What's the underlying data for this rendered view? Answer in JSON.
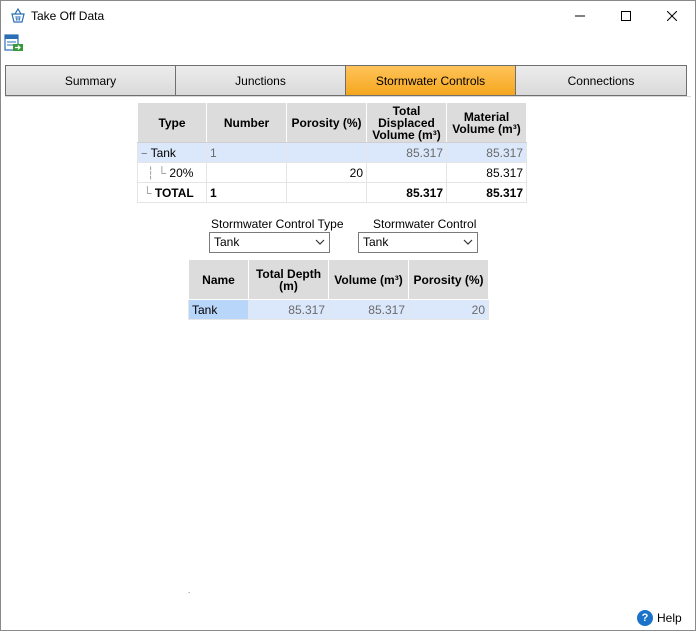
{
  "window": {
    "title": "Take Off Data"
  },
  "tabs": [
    {
      "label": "Summary",
      "active": false
    },
    {
      "label": "Junctions",
      "active": false
    },
    {
      "label": "Stormwater Controls",
      "active": true
    },
    {
      "label": "Connections",
      "active": false
    }
  ],
  "summary_grid": {
    "headers": {
      "type": "Type",
      "number": "Number",
      "porosity": "Porosity (%)",
      "displaced": "Total Displaced Volume (m³)",
      "material": "Material Volume (m³)"
    },
    "rows": [
      {
        "type": "Tank",
        "expander": "−",
        "number": "1",
        "porosity": "",
        "displaced": "85.317",
        "material": "85.317"
      },
      {
        "type": "20%",
        "number": "",
        "porosity": "20",
        "displaced": "",
        "material": "85.317"
      },
      {
        "type": "TOTAL",
        "number": "1",
        "porosity": "",
        "displaced": "85.317",
        "material": "85.317"
      }
    ]
  },
  "filters": {
    "control_type_label": "Stormwater Control Type",
    "control_type_value": "Tank",
    "control_label": "Stormwater Control",
    "control_value": "Tank"
  },
  "detail_grid": {
    "headers": {
      "name": "Name",
      "depth": "Total Depth (m)",
      "volume": "Volume (m³)",
      "porosity": "Porosity (%)"
    },
    "rows": [
      {
        "name": "Tank",
        "depth": "85.317",
        "volume": "85.317",
        "porosity": "20"
      }
    ]
  },
  "status": {
    "help_label": "Help",
    "dot": "."
  },
  "colors": {
    "active_tab": "#f5a61e",
    "selection": "#dbe7fa",
    "help_icon": "#1a73c9"
  }
}
